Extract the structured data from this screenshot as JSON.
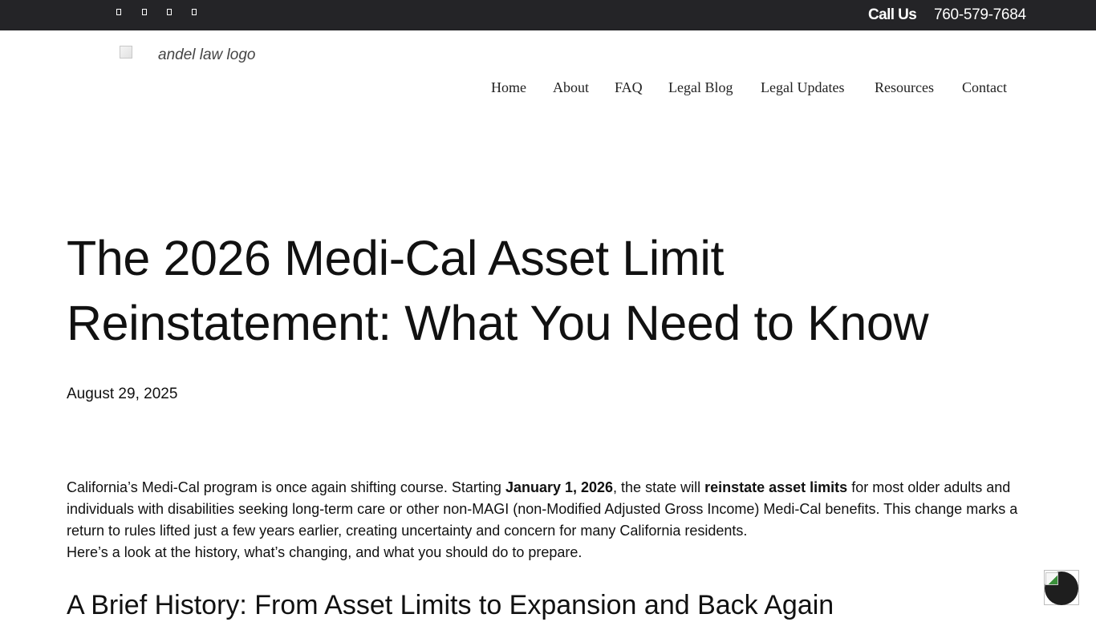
{
  "topbar": {
    "social_icons": [
      "social-icon-1",
      "social-icon-2",
      "social-icon-3",
      "social-icon-4"
    ],
    "call_label": "Call Us",
    "phone": "760-579-7684"
  },
  "header": {
    "logo_alt": "andel law logo",
    "nav": [
      "Home",
      "About",
      "FAQ",
      "Legal Blog",
      "Legal Updates",
      "Resources",
      "Contact"
    ]
  },
  "article": {
    "title_line1": "The 2026 Medi-Cal Asset Limit",
    "title_line2": "Reinstatement: What You Need to Know",
    "date": "August 29, 2025",
    "intro": {
      "p1_a": "California’s Medi-Cal program is once again shifting course. Starting ",
      "p1_b": "January 1, 2026",
      "p1_c": ", the state will ",
      "p1_d": "reinstate asset limits",
      "p1_e": " for most older adults and individuals with disabilities seeking long-term care or other non-MAGI (non-Modified Adjusted Gross Income) Medi-Cal benefits. This change marks a return to rules lifted just a few years earlier, creating uncertainty and concern for many California residents.",
      "p2": "Here’s a look at the history, what’s changing, and what you should do to prepare."
    },
    "heading_history": "A Brief History: From Asset Limits to Expansion and Back Again"
  },
  "colors": {
    "topbar_bg": "#242427",
    "text": "#111111",
    "widget": "#1e1e1e"
  }
}
